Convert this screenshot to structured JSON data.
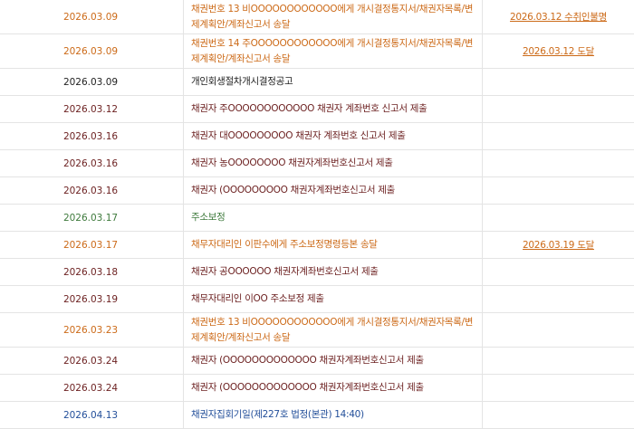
{
  "rows": [
    {
      "date": "2026.03.09",
      "content": "채권번호 13 비OOOOOOOOOOOO에게 개시결정통지서/채권자목록/변제계획안/계좌신고서 송달",
      "result": "2026.03.12 수취인불명",
      "color": "orange",
      "lines": 2
    },
    {
      "date": "2026.03.09",
      "content": "채권번호 14 주OOOOOOOOOOOO에게 개시결정통지서/채권자목록/변제계획안/계좌신고서 송달",
      "result": "2026.03.12 도달",
      "color": "orange",
      "lines": 2
    },
    {
      "date": "2026.03.09",
      "content": "개인회생절차개시결정공고",
      "result": "",
      "color": "black",
      "lines": 1
    },
    {
      "date": "2026.03.12",
      "content": "채권자 주OOOOOOOOOOOO 채권자 계좌번호 신고서 제출",
      "result": "",
      "color": "dark",
      "lines": 1
    },
    {
      "date": "2026.03.16",
      "content": "채권자 대OOOOOOOOO 채권자 계좌번호 신고서 제출",
      "result": "",
      "color": "dark",
      "lines": 1
    },
    {
      "date": "2026.03.16",
      "content": "채권자 농OOOOOOOO 채권자계좌번호신고서 제출",
      "result": "",
      "color": "dark",
      "lines": 1
    },
    {
      "date": "2026.03.16",
      "content": "채권자 (OOOOOOOOO 채권자계좌번호신고서 제출",
      "result": "",
      "color": "dark",
      "lines": 1
    },
    {
      "date": "2026.03.17",
      "content": "주소보정",
      "result": "",
      "color": "green",
      "lines": 1
    },
    {
      "date": "2026.03.17",
      "content": "채무자대리인 이판수에게 주소보정명령등본 송달",
      "result": "2026.03.19 도달",
      "color": "orange",
      "lines": 1
    },
    {
      "date": "2026.03.18",
      "content": "채권자 공OOOOOO 채권자계좌번호신고서 제출",
      "result": "",
      "color": "dark",
      "lines": 1
    },
    {
      "date": "2026.03.19",
      "content": "채무자대리인 이OO 주소보정 제출",
      "result": "",
      "color": "dark",
      "lines": 1
    },
    {
      "date": "2026.03.23",
      "content": "채권번호 13 비OOOOOOOOOOOO에게 개시결정통지서/채권자목록/변제계획안/계좌신고서 송달",
      "result": "",
      "color": "orange",
      "lines": 2
    },
    {
      "date": "2026.03.24",
      "content": "채권자 (OOOOOOOOOOOOO 채권자계좌번호신고서 제출",
      "result": "",
      "color": "dark",
      "lines": 1
    },
    {
      "date": "2026.03.24",
      "content": "채권자 (OOOOOOOOOOOOO 채권자계좌번호신고서 제출",
      "result": "",
      "color": "dark",
      "lines": 1
    },
    {
      "date": "2026.04.13",
      "content": "채권자집회기일(제227호 법정(본관) 14:40)",
      "result": "",
      "color": "blue",
      "lines": 1
    }
  ],
  "colors": {
    "orange": "#cc6a18",
    "dark": "#6b1f1f",
    "black": "#222222",
    "green": "#3e7a3c",
    "blue": "#234f9a",
    "border": "#e4e4e4"
  }
}
